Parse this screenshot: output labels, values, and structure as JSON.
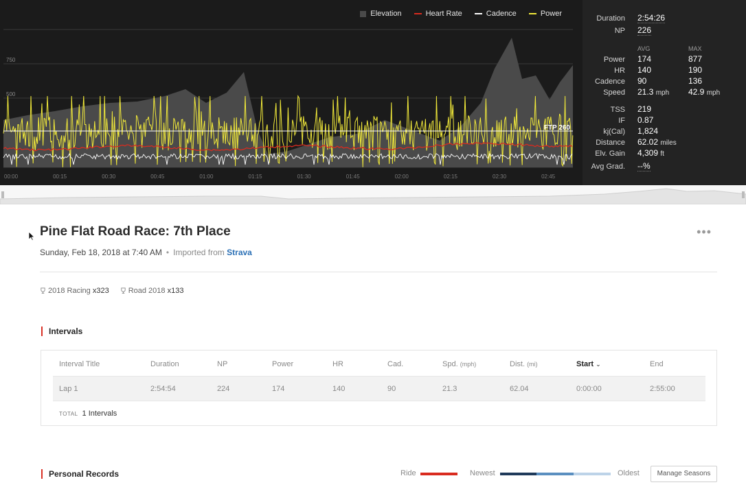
{
  "legend": {
    "elevation": "Elevation",
    "heart_rate": "Heart Rate",
    "cadence": "Cadence",
    "power": "Power",
    "colors": {
      "elevation": "#4a4a4a",
      "heart_rate": "#d92b1f",
      "cadence": "#ffffff",
      "power": "#f2ea3a"
    }
  },
  "chart": {
    "y_ticks": [
      "750",
      "500"
    ],
    "ftp_label": "FTP 260",
    "x_ticks": [
      "00:00",
      "00:15",
      "00:30",
      "00:45",
      "01:00",
      "01:15",
      "01:30",
      "01:45",
      "02:00",
      "02:15",
      "02:30",
      "02:45"
    ]
  },
  "stats": {
    "duration_label": "Duration",
    "duration": "2:54:26",
    "np_label": "NP",
    "np": "226",
    "avg_head": "AVG",
    "max_head": "MAX",
    "power_label": "Power",
    "power_avg": "174",
    "power_max": "877",
    "hr_label": "HR",
    "hr_avg": "140",
    "hr_max": "190",
    "cadence_label": "Cadence",
    "cadence_avg": "90",
    "cadence_max": "136",
    "speed_label": "Speed",
    "speed_avg": "21.3",
    "speed_max": "42.9",
    "speed_unit": "mph",
    "tss_label": "TSS",
    "tss": "219",
    "if_label": "IF",
    "if": "0.87",
    "kj_label": "kj(Cal)",
    "kj": "1,824",
    "distance_label": "Distance",
    "distance": "62.02",
    "distance_unit": "miles",
    "elv_label": "Elv. Gain",
    "elv": "4,309",
    "elv_unit": "ft",
    "grad_label": "Avg Grad.",
    "grad": "--%"
  },
  "activity": {
    "title": "Pine Flat Road Race: 7th Place",
    "date": "Sunday, Feb 18, 2018 at 7:40 AM",
    "imported_label": "Imported from",
    "source": "Strava",
    "more": "•••"
  },
  "tags": [
    {
      "name": "2018 Racing",
      "count": "x323"
    },
    {
      "name": "Road 2018",
      "count": "x133"
    }
  ],
  "intervals": {
    "heading": "Intervals",
    "columns": {
      "title": "Interval Title",
      "duration": "Duration",
      "np": "NP",
      "power": "Power",
      "hr": "HR",
      "cad": "Cad.",
      "spd": "Spd.",
      "spd_unit": "(mph)",
      "dist": "Dist.",
      "dist_unit": "(mi)",
      "start": "Start",
      "end": "End"
    },
    "rows": [
      {
        "title": "Lap 1",
        "duration": "2:54:54",
        "np": "224",
        "power": "174",
        "hr": "140",
        "cad": "90",
        "spd": "21.3",
        "dist": "62.04",
        "start": "0:00:00",
        "end": "2:55:00"
      }
    ],
    "total_label": "TOTAL",
    "total_value": "1 Intervals"
  },
  "personal_records": {
    "heading": "Personal Records",
    "ride_label": "Ride",
    "newest_label": "Newest",
    "oldest_label": "Oldest",
    "manage_label": "Manage Seasons",
    "ride_color": "#d92b1f",
    "season_colors": [
      "#1f3a5a",
      "#5b8fc0",
      "#bdd3e8"
    ]
  }
}
